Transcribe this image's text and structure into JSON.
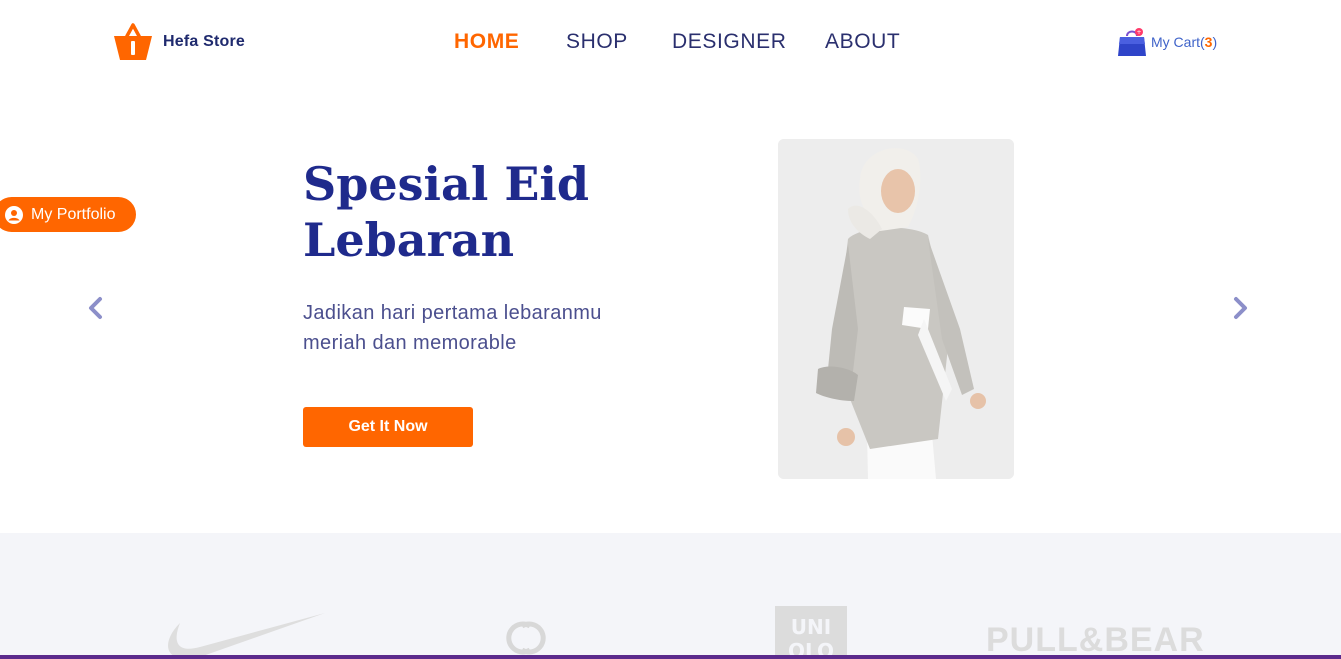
{
  "header": {
    "brand_name": "Hefa Store",
    "logo_icon": "shopping-basket-icon",
    "nav": [
      {
        "label": "HOME",
        "active": true
      },
      {
        "label": "SHOP",
        "active": false
      },
      {
        "label": "DESIGNER",
        "active": false
      },
      {
        "label": "ABOUT",
        "active": false
      }
    ],
    "cart": {
      "icon": "shopping-bag-icon",
      "label_prefix": "My Cart(",
      "count": "3",
      "label_suffix": ")"
    }
  },
  "portfolio": {
    "icon": "user-circle-icon",
    "label": "My Portfolio"
  },
  "hero": {
    "title": "Spesial Eid Lebaran",
    "subtitle": "Jadikan hari pertama lebaranmu meriah dan memorable",
    "cta_label": "Get It Now",
    "prev_icon": "chevron-left-icon",
    "next_icon": "chevron-right-icon"
  },
  "brands": {
    "pullbear_text": "PULL&BEAR",
    "logos": [
      "nike-logo",
      "chanel-logo",
      "uniqlo-logo",
      "pull-and-bear-logo"
    ]
  },
  "colors": {
    "accent": "#ff6600",
    "primary_text": "#1f2a8c",
    "brand_strip_bg": "#f4f5f9"
  }
}
